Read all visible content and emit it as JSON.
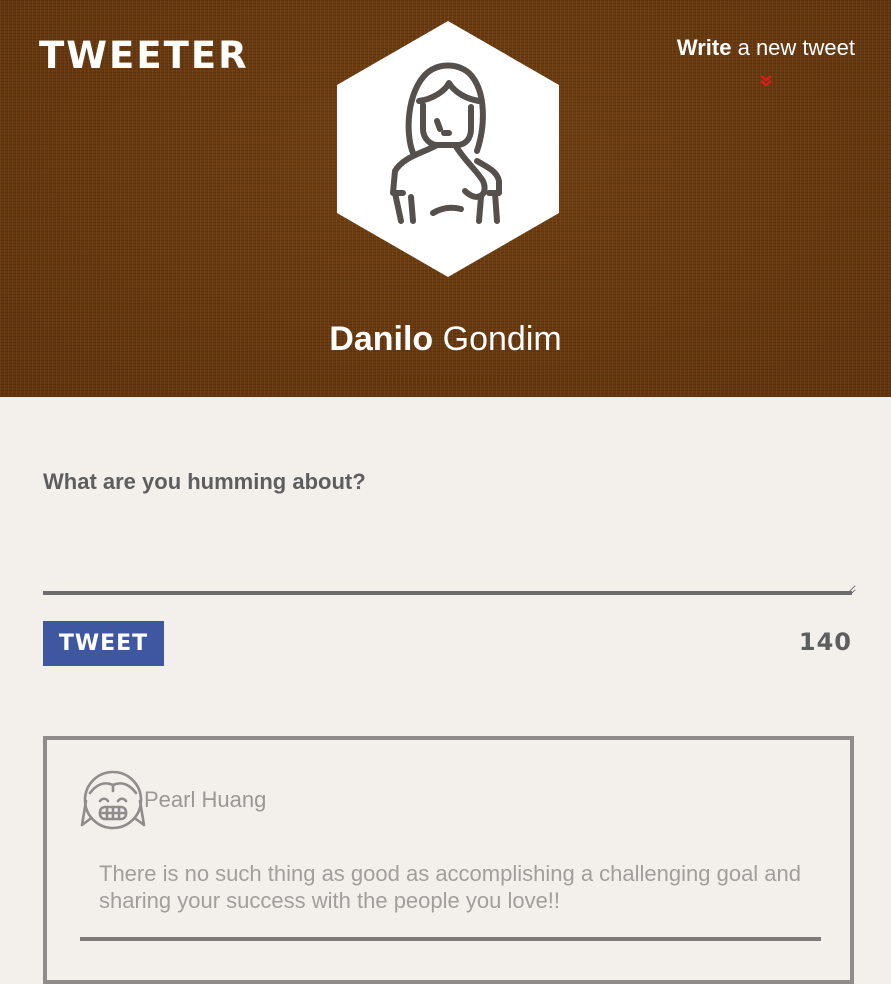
{
  "header": {
    "logo": "TWEETER",
    "write_link_bold": "Write",
    "write_link_rest": " a new tweet",
    "write_link_icon": "double-chevron-down-icon",
    "profile_first_name": "Danilo",
    "profile_last_name": "Gondim",
    "avatar_icon": "woman-avatar-icon"
  },
  "composer": {
    "label": "What are you humming about?",
    "value": "",
    "button_label": "TWEET",
    "char_count": "140"
  },
  "tweets": [
    {
      "author": "Pearl Huang",
      "avatar_icon": "girl-avatar-icon",
      "content": "There is no such thing as good as accomplishing a challenging goal and sharing your success with the people you love!!"
    }
  ],
  "colors": {
    "header_bg": "#6e3c10",
    "page_bg": "#f3f0ec",
    "button_bg": "#3f57a0",
    "chevron": "#e01b1b",
    "text_gray": "#5e5e5e"
  }
}
